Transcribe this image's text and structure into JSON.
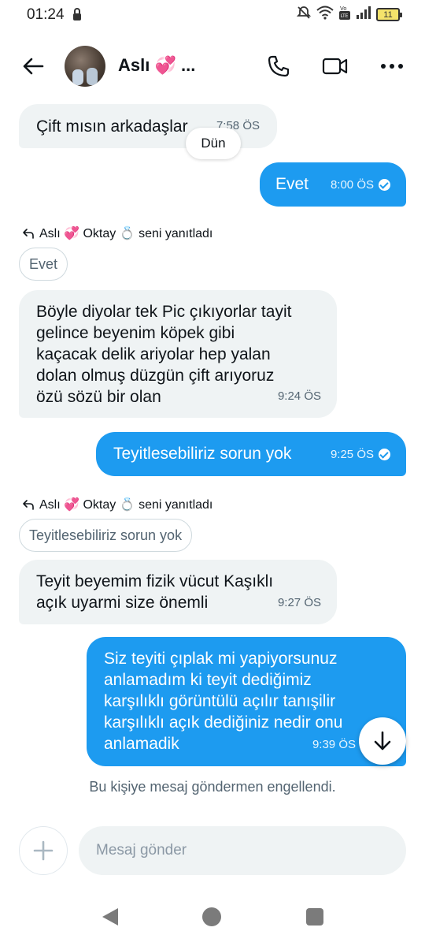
{
  "status_bar": {
    "time": "01:24",
    "battery": "11",
    "icons": [
      "lock-icon",
      "mute-icon",
      "wifi-icon",
      "volte-icon",
      "signal-icon",
      "battery-icon"
    ]
  },
  "header": {
    "name": "Aslı 💞 ...",
    "icons": [
      "back-arrow-icon",
      "phone-icon",
      "video-camera-icon",
      "more-icon"
    ]
  },
  "chat": {
    "day_label": "Dün",
    "messages": [
      {
        "dir": "in",
        "text": "Çift mısın arkadaşlar",
        "time": "7:58 ÖS"
      },
      {
        "dir": "out",
        "text": "Evet",
        "time": "8:00 ÖS"
      },
      {
        "reply_header": "Aslı 💞 Oktay 💍 seni yanıtladı",
        "quoted": "Evet"
      },
      {
        "dir": "in",
        "text": "Böyle diyolar tek Pic çıkıyorlar tayit\ngelince beyenim köpek gibi\nkaçacak delik ariyolar hep yalan\ndolan olmuş düzgün çift arıyoruz\nözü sözü bir olan",
        "time": "9:24 ÖS"
      },
      {
        "dir": "out",
        "text": "Teyitlesebiliriz sorun yok",
        "time": "9:25 ÖS"
      },
      {
        "reply_header": "Aslı 💞 Oktay 💍 seni yanıtladı",
        "quoted": "Teyitlesebiliriz sorun yok"
      },
      {
        "dir": "in",
        "text": "Teyit beyemim fizik vücut Kaşıklı\naçık uyarmi size önemli",
        "time": "9:27 ÖS"
      },
      {
        "dir": "out",
        "text": "Siz teyiti çıplak mi yapiyorsunuz\nanlamadım ki teyit dediğimiz\nkarşılıklı görüntülü açılır tanışilir\nkarşılıklı açık dediğiniz nedir onu\nanlamadik",
        "time": "9:39 ÖS"
      }
    ],
    "blocked_notice": "Bu kişiye mesaj göndermen engellendi."
  },
  "composer": {
    "placeholder": "Mesaj gönder"
  },
  "colors": {
    "accent": "#1d9bf0",
    "incoming_bg": "#eff3f4",
    "secondary_text": "#536471"
  }
}
